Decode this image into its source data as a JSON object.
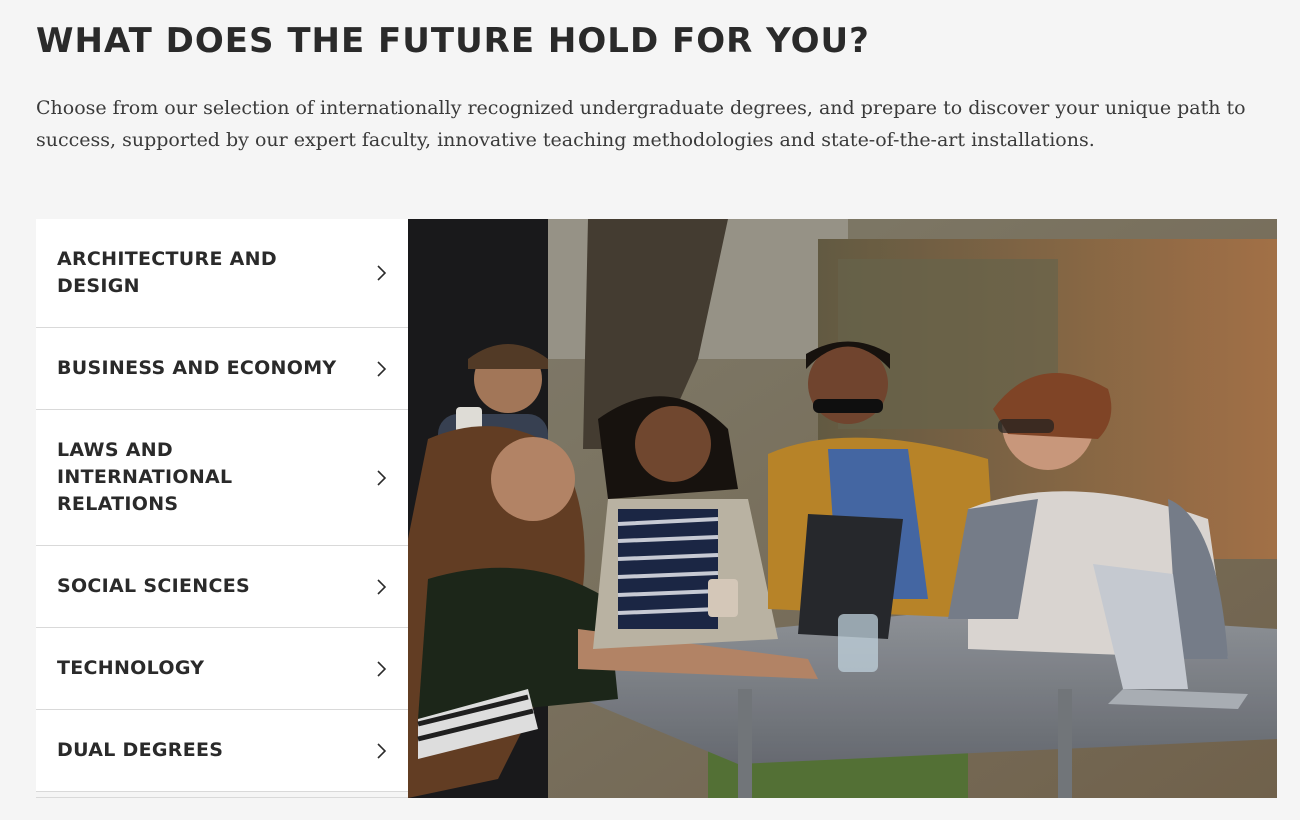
{
  "page": {
    "heading": "WHAT DOES THE FUTURE HOLD FOR YOU?",
    "intro": "Choose from our selection of internationally recognized undergraduate degrees, and prepare to discover your unique path to success, supported by our expert faculty, innovative teaching methodologies and state-of-the-art installations."
  },
  "degrees": {
    "items": [
      {
        "label": "ARCHITECTURE AND DESIGN",
        "icon": "chevron-right-icon"
      },
      {
        "label": "BUSINESS AND ECONOMY",
        "icon": "chevron-right-icon"
      },
      {
        "label": "LAWS AND INTERNATIONAL RELATIONS",
        "icon": "chevron-right-icon"
      },
      {
        "label": "SOCIAL SCIENCES",
        "icon": "chevron-right-icon"
      },
      {
        "label": "TECHNOLOGY",
        "icon": "chevron-right-icon"
      },
      {
        "label": "DUAL DEGREES",
        "icon": "chevron-right-icon"
      }
    ]
  },
  "photo": {
    "subject": "students-at-outdoor-table"
  },
  "colors": {
    "background": "#f5f5f5",
    "text": "#2a2a2a",
    "menu_bg": "#ffffff",
    "divider": "#d9d9d9"
  }
}
